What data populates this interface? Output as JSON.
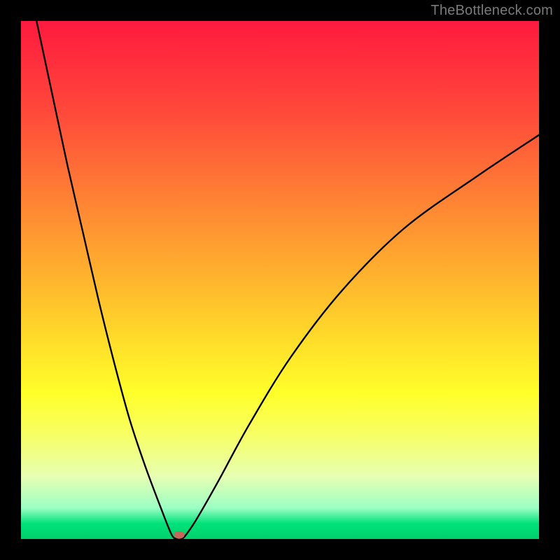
{
  "watermark": "TheBottleneck.com",
  "chart_data": {
    "type": "line",
    "title": "",
    "xlabel": "",
    "ylabel": "",
    "xlim": [
      0,
      100
    ],
    "ylim": [
      0,
      100
    ],
    "grid": false,
    "series": [
      {
        "name": "bottleneck-curve",
        "x": [
          3,
          6,
          9,
          12,
          15,
          18,
          21,
          24,
          27,
          29,
          30,
          31,
          32,
          34,
          38,
          44,
          52,
          62,
          74,
          88,
          100
        ],
        "values": [
          100,
          86,
          72,
          59,
          46,
          34,
          23,
          14,
          6,
          1,
          0,
          0,
          1,
          4,
          11,
          22,
          35,
          48,
          60,
          70,
          78
        ]
      }
    ],
    "marker": {
      "x": 30.5,
      "y": 0.8,
      "color": "#c4685a"
    },
    "background_gradient": {
      "top": "#ff1a3f",
      "mid": "#ffff2a",
      "bottom": "#00d06c"
    }
  }
}
